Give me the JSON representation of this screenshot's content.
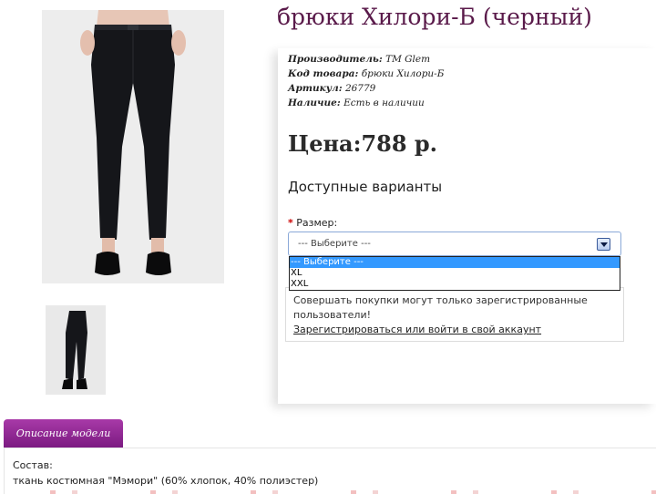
{
  "product": {
    "title": "брюки Хилори-Б (черный)",
    "manufacturer_label": "Производитель:",
    "manufacturer_value": "ТМ Glem",
    "code_label": "Код товара:",
    "code_value": "брюки Хилори-Б",
    "article_label": "Артикул:",
    "article_value": "26779",
    "availability_label": "Наличие:",
    "availability_value": "Есть в наличии",
    "price": "Цена:788 р."
  },
  "options": {
    "heading": "Доступные варианты",
    "required_mark": "*",
    "size_label": "Размер:",
    "selected": "--- Выберите ---",
    "dropdown_items": [
      "--- Выберите ---",
      "XL",
      "XXL"
    ]
  },
  "notice": {
    "text": "Совершать покупки могут только зарегистрированные пользователи!",
    "link": "Зарегистрироваться или войти в свой аккаунт"
  },
  "tabs": {
    "description": "Описание модели"
  },
  "description": {
    "composition_label": "Состав:",
    "composition_text": "ткань костюмная \"Мэмори\" (60% хлопок, 40% полиэстер)"
  },
  "colors": {
    "title": "#5a1a4a",
    "tab": "#8e2a92",
    "dropdown_highlight": "#3399ff",
    "required": "#cc0000"
  }
}
